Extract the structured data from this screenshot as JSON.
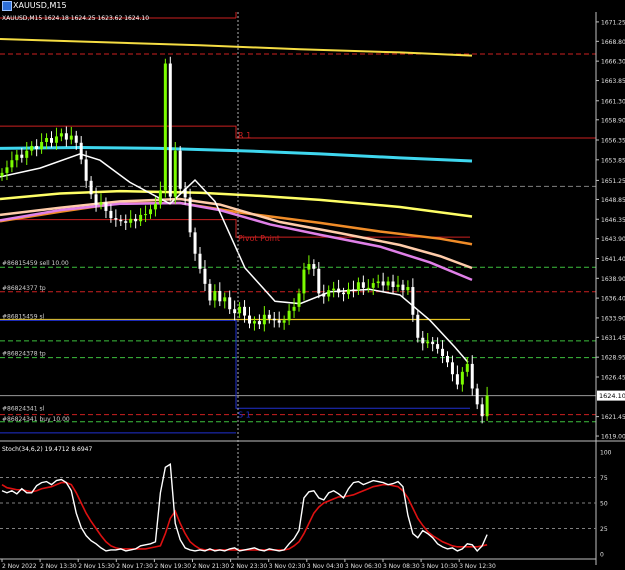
{
  "window": {
    "title": "XAUUSD,M15"
  },
  "ohlc_header": "XAUUSD,M15  1624.18  1624.25  1623.62  1624.10",
  "price_axis": {
    "ticks": [
      "1671.25",
      "1668.80",
      "1666.30",
      "1663.85",
      "1661.30",
      "1658.90",
      "1656.35",
      "1653.85",
      "1651.25",
      "1648.85",
      "1646.35",
      "1643.90",
      "1641.40",
      "1638.90",
      "1636.40",
      "1633.90",
      "1631.45",
      "1628.95",
      "1626.45",
      "1621.45",
      "1619.00"
    ],
    "current_price": "1624.10"
  },
  "level_labels": {
    "r1": "R 1",
    "pivot": "Pivot Point",
    "s1": "S 1",
    "sell": "#86815459 sell 10.00",
    "tp1": "#86824377 tp",
    "sl1": "#86815459 sl",
    "tp2": "#86824378 tp",
    "sl2": "#86824341 sl",
    "buy": "#86824341 buy 10.00"
  },
  "stoch": {
    "header": "Stoch(34,6,2) 19.4712 8.6947",
    "ticks": [
      "100",
      "75",
      "50",
      "25",
      "0"
    ]
  },
  "time_axis": [
    "2 Nov 2022",
    "2 Nov 13:30",
    "2 Nov 15:30",
    "2 Nov 17:30",
    "2 Nov 19:30",
    "2 Nov 21:30",
    "2 Nov 23:30",
    "3 Nov 02:30",
    "3 Nov 04:30",
    "3 Nov 06:30",
    "3 Nov 08:30",
    "3 Nov 10:30",
    "3 Nov 12:30"
  ],
  "colors": {
    "bull_candle": "#7cfc00",
    "bear_candle": "#ffffff",
    "grid": "#808080",
    "ma_white": "#ffffff",
    "ma_cyan": "#3fd7ef",
    "ma_yellow": "#ffff66",
    "ma_yellow2": "#f5dd43",
    "ma_orange": "#f08c28",
    "ma_peach": "#ffccaa",
    "ma_pink": "#e080e8",
    "level_red": "#cc2020",
    "level_green": "#3dbf3d",
    "level_yellow": "#e6c520",
    "level_blue": "#2030d0",
    "stoch_main": "#ffffff",
    "stoch_signal": "#dd1111"
  },
  "chart_data": {
    "type": "candlestick",
    "title": "XAUUSD,M15",
    "ylim": [
      1618.5,
      1672.5
    ],
    "close": [
      1652.2,
      1652.9,
      1653.8,
      1654.5,
      1654.1,
      1655.0,
      1655.6,
      1655.2,
      1656.1,
      1656.6,
      1656.0,
      1656.8,
      1657.2,
      1656.4,
      1656.9,
      1656.0,
      1653.9,
      1651.2,
      1649.5,
      1648.2,
      1648.5,
      1647.4,
      1646.5,
      1646.3,
      1646.1,
      1645.9,
      1646.4,
      1646.1,
      1646.9,
      1647.0,
      1647.6,
      1648.3,
      1650.0,
      1666.0,
      1649.2,
      1655.0,
      1650.2,
      1649.1,
      1644.7,
      1642.0,
      1640.1,
      1638.2,
      1636.1,
      1637.3,
      1636.0,
      1636.5,
      1635.0,
      1634.5,
      1635.3,
      1634.2,
      1633.2,
      1633.5,
      1633.1,
      1634.3,
      1633.8,
      1633.6,
      1633.3,
      1633.6,
      1634.8,
      1635.3,
      1637.0,
      1640.0,
      1640.7,
      1640.1,
      1637.0,
      1636.6,
      1637.4,
      1637.6,
      1637.1,
      1636.9,
      1637.5,
      1637.4,
      1638.4,
      1637.7,
      1637.7,
      1638.3,
      1638.5,
      1638.0,
      1638.5,
      1637.8,
      1638.1,
      1637.4,
      1637.8,
      1634.3,
      1631.4,
      1630.7,
      1630.9,
      1630.6,
      1630.0,
      1629.1,
      1628.3,
      1626.8,
      1625.5,
      1627.1,
      1628.1,
      1625.0,
      1623.0,
      1621.5,
      1624.1
    ],
    "levels": {
      "r1": 1658.1,
      "pivot": 1645.0,
      "s1": 1622.5
    },
    "stoch_main": [
      62,
      60,
      62,
      59,
      64,
      60,
      60,
      67,
      70,
      71,
      68,
      72,
      73,
      70,
      62,
      40,
      26,
      18,
      13,
      10,
      6,
      3,
      4,
      4,
      5,
      3,
      4,
      5,
      8,
      9,
      10,
      12,
      60,
      85,
      88,
      30,
      14,
      6,
      4,
      3,
      4,
      3,
      5,
      3,
      4,
      3,
      5,
      6,
      3,
      4,
      5,
      6,
      4,
      3,
      5,
      4,
      3,
      4,
      10,
      15,
      23,
      55,
      61,
      62,
      55,
      53,
      60,
      62,
      59,
      55,
      64,
      70,
      71,
      68,
      70,
      72,
      71,
      70,
      68,
      69,
      71,
      66,
      38,
      20,
      16,
      23,
      20,
      16,
      10,
      7,
      5,
      6,
      3,
      5,
      10,
      9,
      3,
      8,
      19
    ],
    "stoch_signal": [
      68,
      65,
      64,
      63,
      63,
      62,
      61,
      62,
      64,
      65,
      66,
      68,
      70,
      70,
      68,
      60,
      50,
      40,
      32,
      25,
      18,
      12,
      8,
      6,
      5,
      5,
      5,
      5,
      5,
      5,
      6,
      7,
      8,
      20,
      35,
      42,
      30,
      20,
      12,
      8,
      5,
      4,
      4,
      4,
      4,
      4,
      4,
      4,
      4,
      4,
      4,
      4,
      4,
      4,
      4,
      4,
      4,
      4,
      5,
      8,
      12,
      20,
      30,
      40,
      46,
      50,
      52,
      54,
      56,
      56,
      57,
      58,
      60,
      62,
      64,
      66,
      67,
      68,
      68,
      67,
      66,
      62,
      55,
      45,
      35,
      28,
      22,
      18,
      15,
      12,
      10,
      8,
      7,
      7,
      7,
      7,
      7,
      8,
      9
    ],
    "stoch_ylim": [
      0,
      100
    ]
  }
}
